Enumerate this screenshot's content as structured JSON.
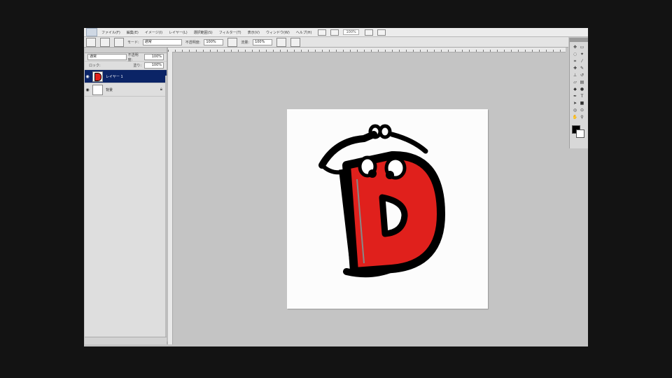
{
  "app": {
    "menus": [
      "ファイル(F)",
      "編集(E)",
      "イメージ(I)",
      "レイヤー(L)",
      "選択範囲(S)",
      "フィルター(T)",
      "表示(V)",
      "ウィンドウ(W)",
      "ヘルプ(H)"
    ],
    "zoom": "100%"
  },
  "options": {
    "mode_label": "モード:",
    "mode_value": "通常",
    "opacity_label": "不透明度:",
    "opacity_value": "100%",
    "flow_label": "流量:",
    "flow_value": "100%"
  },
  "layers_panel": {
    "blend_mode": "通常",
    "opacity_label": "不透明度:",
    "opacity_value": "100%",
    "lock_label": "ロック:",
    "fill_label": "塗り:",
    "fill_value": "100%",
    "layers": [
      {
        "name": "レイヤー 1",
        "selected": true
      },
      {
        "name": "背景",
        "selected": false
      }
    ]
  },
  "colors": {
    "foreground": "#000000",
    "background": "#ffffff",
    "selection": "#0b2466",
    "letter_fill": "#e0201c"
  },
  "icons": [
    "eye-icon",
    "lock-icon",
    "brush-icon",
    "move-icon",
    "marquee-icon",
    "lasso-icon",
    "crop-icon",
    "eraser-icon",
    "zoom-icon",
    "hand-icon"
  ]
}
